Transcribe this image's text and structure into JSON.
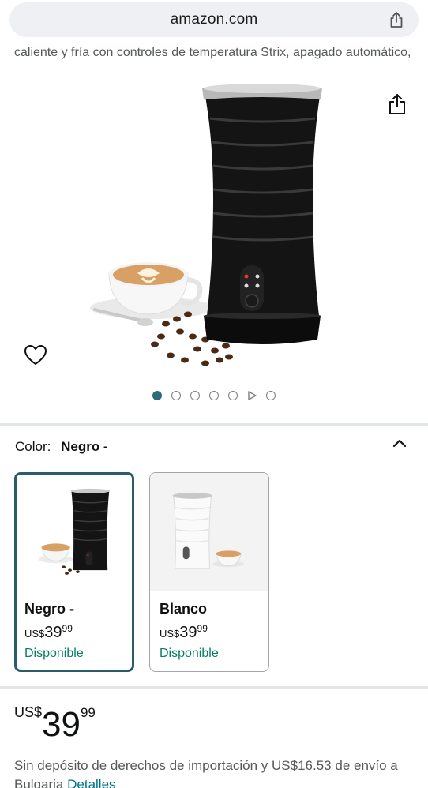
{
  "browser": {
    "url": "amazon.com"
  },
  "product": {
    "description_fragment": "caliente y fría con controles de temperatura Strix, apagado automático,",
    "image_dots_count": 7,
    "image_dot_active": 0
  },
  "color_selector": {
    "label": "Color:",
    "selected_value": "Negro -",
    "options": [
      {
        "name": "Negro -",
        "price_currency": "US$",
        "price_whole": "39",
        "price_cents": "99",
        "availability": "Disponible",
        "selected": true
      },
      {
        "name": "Blanco",
        "price_currency": "US$",
        "price_whole": "39",
        "price_cents": "99",
        "availability": "Disponible",
        "selected": false
      }
    ]
  },
  "price": {
    "currency": "US$",
    "whole": "39",
    "cents": "99"
  },
  "shipping": {
    "text": "Sin depósito de derechos de importación y US$16.53 de envío a Bulgaria",
    "link": "Detalles"
  },
  "colors": {
    "accent": "#2e6b76",
    "available": "#067d62",
    "link": "#007185"
  }
}
